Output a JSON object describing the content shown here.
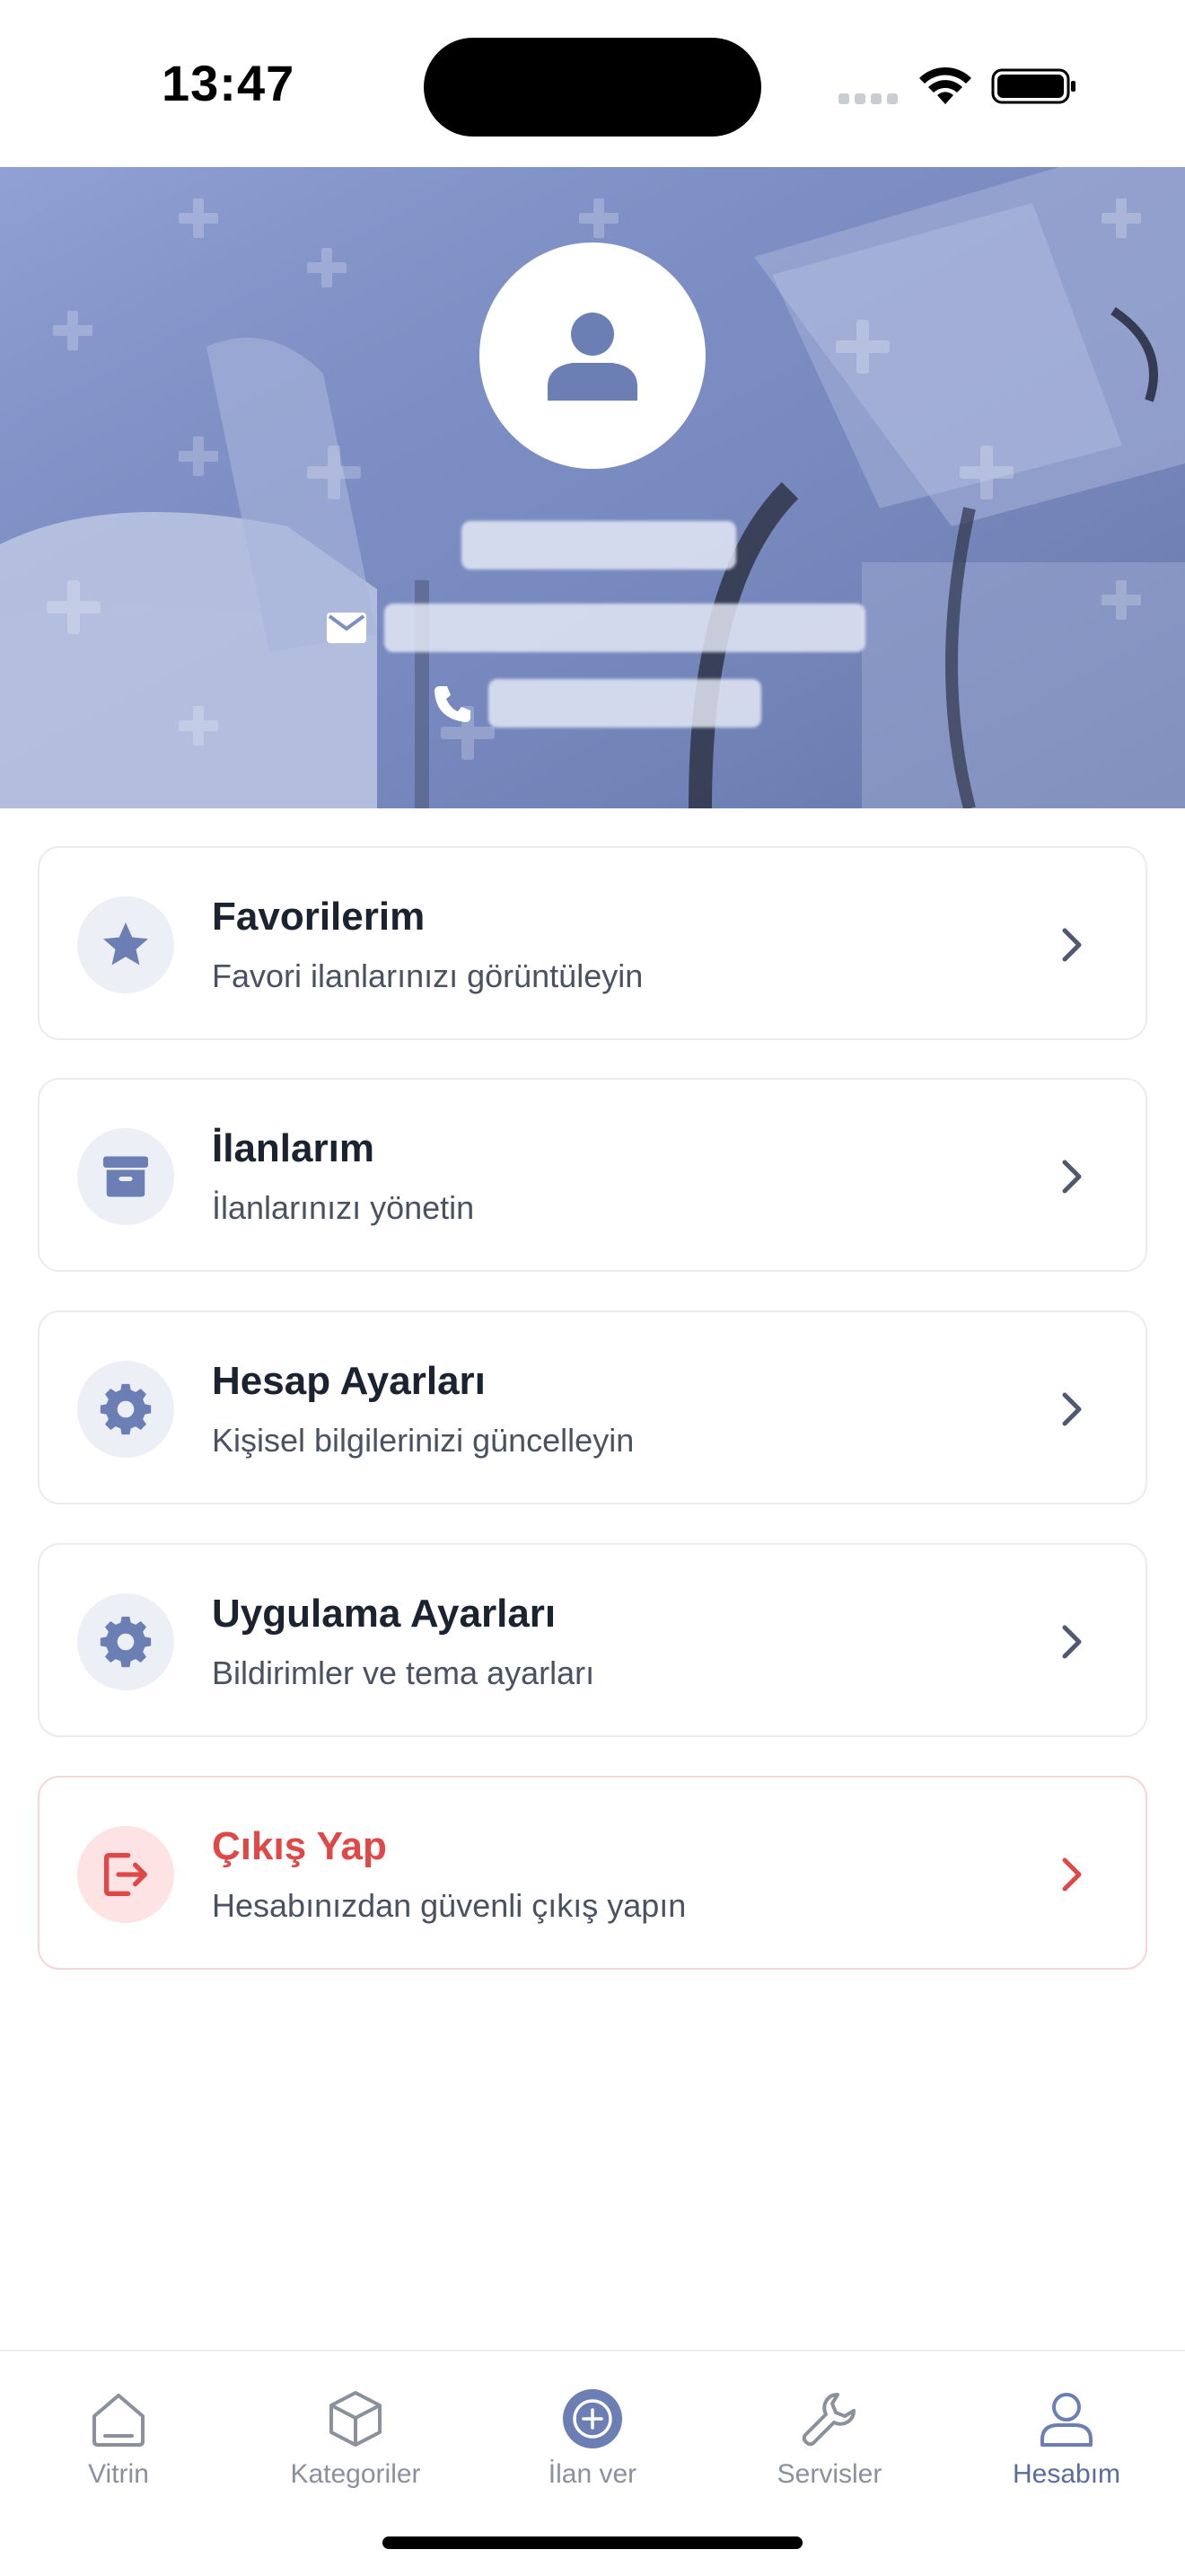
{
  "status_bar": {
    "time": "13:47"
  },
  "profile": {
    "name": "",
    "email": "",
    "phone": ""
  },
  "menu": [
    {
      "title": "Favorilerim",
      "subtitle": "Favori ilanlarınızı görüntüleyin",
      "icon": "star-icon"
    },
    {
      "title": "İlanlarım",
      "subtitle": "İlanlarınızı yönetin",
      "icon": "archive-icon"
    },
    {
      "title": "Hesap Ayarları",
      "subtitle": "Kişisel bilgilerinizi güncelleyin",
      "icon": "gear-icon"
    },
    {
      "title": "Uygulama Ayarları",
      "subtitle": "Bildirimler ve tema ayarları",
      "icon": "gear-icon"
    },
    {
      "title": "Çıkış Yap",
      "subtitle": "Hesabınızdan güvenli çıkış yapın",
      "icon": "logout-icon"
    }
  ],
  "tabs": [
    {
      "label": "Vitrin",
      "icon": "home-icon"
    },
    {
      "label": "Kategoriler",
      "icon": "cube-icon"
    },
    {
      "label": "İlan ver",
      "icon": "plus-circle-icon"
    },
    {
      "label": "Servisler",
      "icon": "wrench-icon"
    },
    {
      "label": "Hesabım",
      "icon": "user-icon",
      "active": true
    }
  ],
  "colors": {
    "accent": "#6b7fb5",
    "danger": "#e04848",
    "banner": "#7e8fc6"
  }
}
